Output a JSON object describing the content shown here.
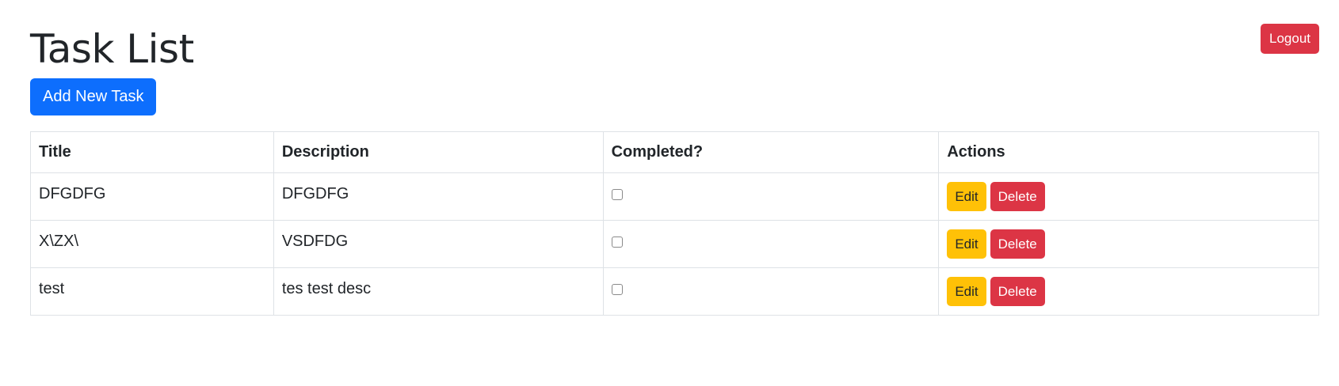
{
  "header": {
    "title": "Task List",
    "add_button_label": "Add New Task",
    "logout_label": "Logout"
  },
  "table": {
    "columns": [
      "Title",
      "Description",
      "Completed?",
      "Actions"
    ],
    "rows": [
      {
        "title": "DFGDFG",
        "description": "DFGDFG",
        "completed": false,
        "edit_label": "Edit",
        "delete_label": "Delete"
      },
      {
        "title": "X\\ZX\\",
        "description": "VSDFDG",
        "completed": false,
        "edit_label": "Edit",
        "delete_label": "Delete"
      },
      {
        "title": "test",
        "description": "tes test desc",
        "completed": false,
        "edit_label": "Edit",
        "delete_label": "Delete"
      }
    ]
  },
  "colors": {
    "primary": "#0d6efd",
    "danger": "#dc3545",
    "warning": "#ffc107"
  }
}
